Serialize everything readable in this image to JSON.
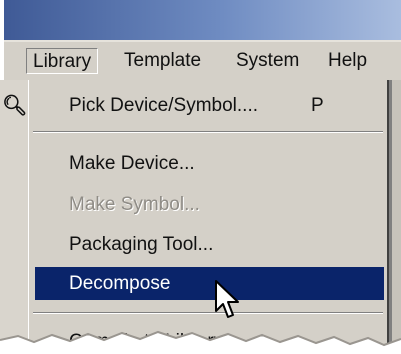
{
  "menubar": {
    "items": [
      {
        "label": "Library",
        "active": true
      },
      {
        "label": "Template",
        "active": false
      },
      {
        "label": "System",
        "active": false
      },
      {
        "label": "Help",
        "active": false
      }
    ]
  },
  "dropdown": {
    "items": [
      {
        "label": "Pick Device/Symbol....",
        "shortcut": "P",
        "enabled": true,
        "highlighted": false
      },
      {
        "label": "Make Device...",
        "enabled": true,
        "highlighted": false
      },
      {
        "label": "Make Symbol...",
        "enabled": false,
        "highlighted": false
      },
      {
        "label": "Packaging Tool...",
        "enabled": true,
        "highlighted": false
      },
      {
        "label": "Decompose",
        "enabled": true,
        "highlighted": true
      },
      {
        "label": "Compile to Library...",
        "enabled": true,
        "highlighted": false
      }
    ]
  },
  "colors": {
    "menu_background": "#d4d0c8",
    "highlight": "#0a246a",
    "disabled_text": "#8f8c86"
  },
  "icons": {
    "toolbar": "zoom-icon",
    "cursor": "mouse-pointer-icon"
  }
}
